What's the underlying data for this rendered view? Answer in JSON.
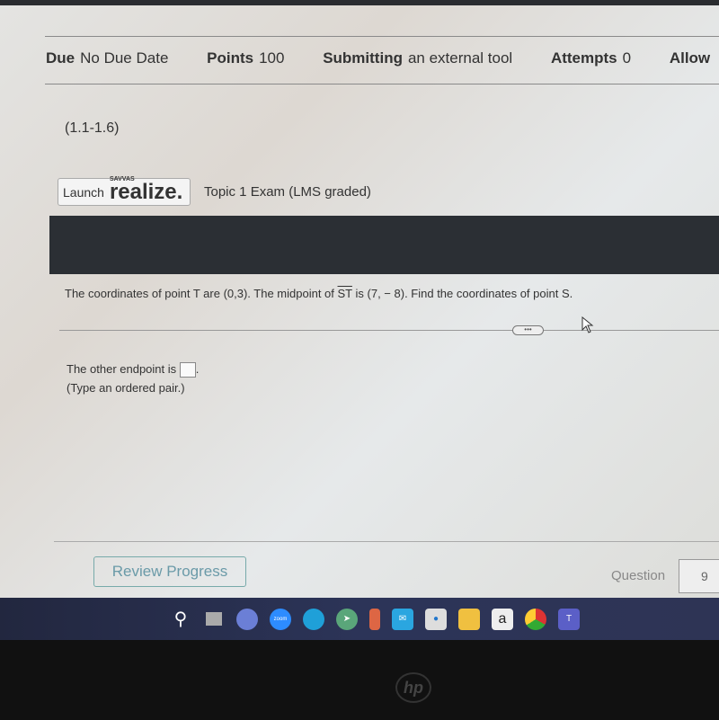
{
  "details": {
    "due_label": "Due",
    "due_value": "No Due Date",
    "points_label": "Points",
    "points_value": "100",
    "submitting_label": "Submitting",
    "submitting_value": "an external tool",
    "attempts_label": "Attempts",
    "attempts_value": "0",
    "allowed_label": "Allow"
  },
  "section": "(1.1-1.6)",
  "launch": {
    "label": "Launch",
    "brand_small": "SAVVAS",
    "brand": "realize."
  },
  "topic": "Topic 1 Exam (LMS graded)",
  "question": {
    "text_a": "The coordinates of point T are (0,3). The midpoint of ",
    "segment": "ST",
    "text_b": " is (7, − 8). Find the coordinates of point S.",
    "more": "•••"
  },
  "answer": {
    "prefix": "The other endpoint is ",
    "suffix": ".",
    "hint": "(Type an ordered pair.)",
    "value": ""
  },
  "footer": {
    "review": "Review Progress",
    "question_label": "Question",
    "question_number": "9"
  },
  "taskbar": {
    "apps": [
      "windows-start",
      "search",
      "task-view",
      "teams-chat",
      "zoom",
      "edge",
      "send",
      "office",
      "mail",
      "contacts",
      "file-explorer",
      "amazon",
      "chrome",
      "teams"
    ],
    "zoom_label": "zoom",
    "amazon_label": "a"
  },
  "bezel_logo": "hp"
}
